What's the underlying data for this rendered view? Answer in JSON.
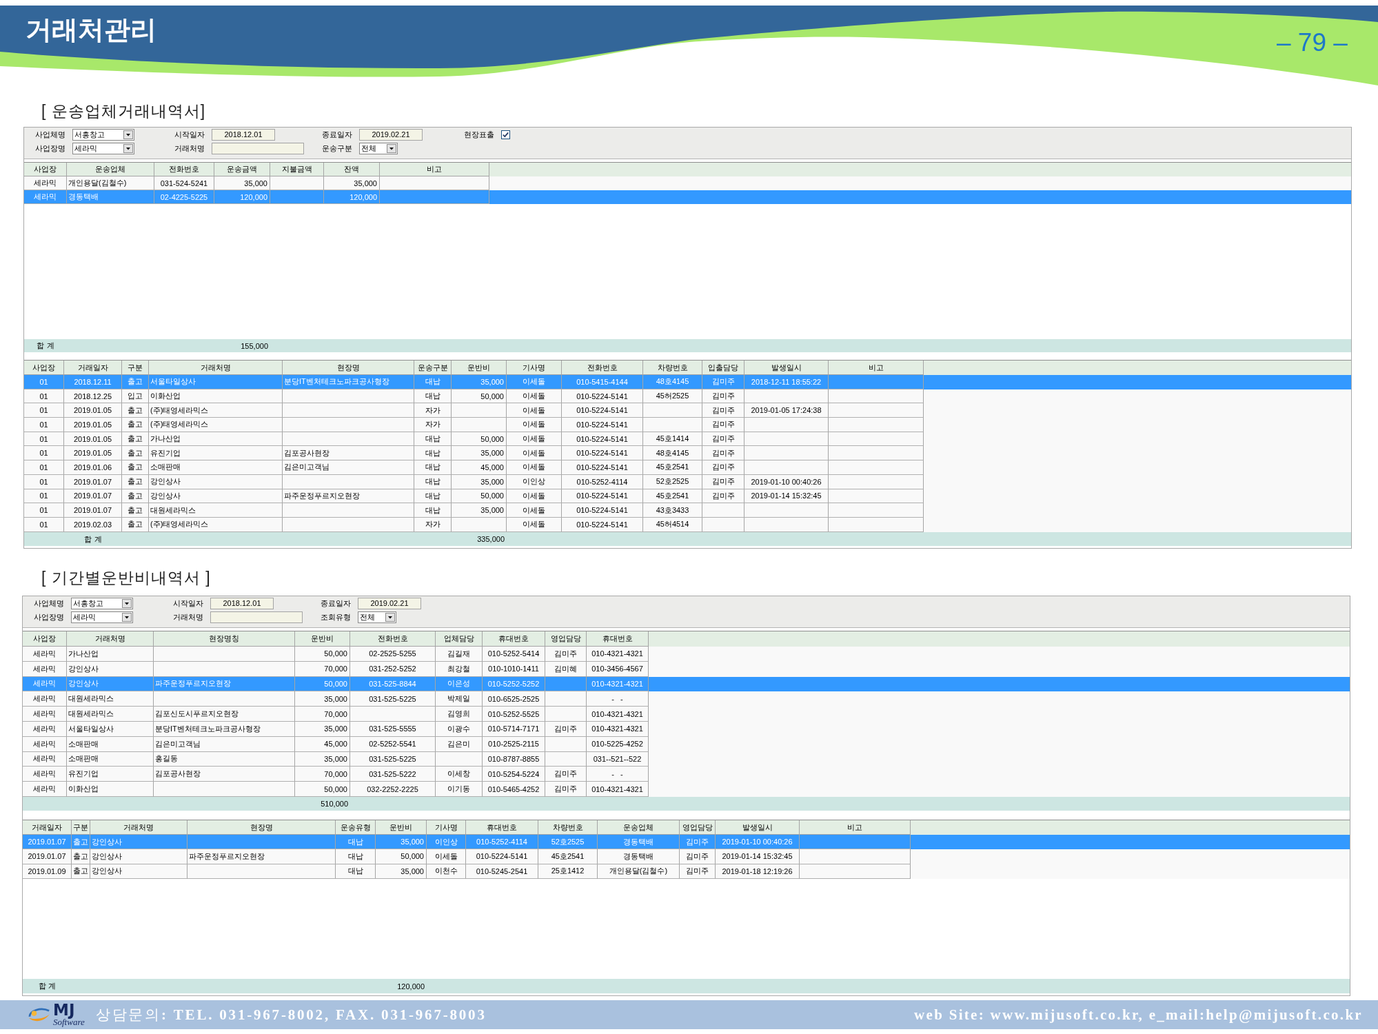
{
  "header": {
    "title": "거래처관리",
    "page_number": "– 79 –"
  },
  "sections": [
    {
      "title": "[ 운송업체거래내역서]",
      "filters": [
        [
          {
            "label": "사업체명",
            "kind": "dropdown",
            "value": "서흥창고"
          },
          {
            "label": "시작일자",
            "kind": "date",
            "value": "2018.12.01"
          },
          {
            "label": "종료일자",
            "kind": "date",
            "value": "2019.02.21"
          },
          {
            "label": "현장표출",
            "kind": "checkbox",
            "checked": true
          }
        ],
        [
          {
            "label": "사업장명",
            "kind": "dropdown",
            "value": "세라믹"
          },
          {
            "label": "거래처명",
            "kind": "text"
          },
          {
            "label": "운송구분",
            "kind": "dropdown",
            "value": "전체"
          }
        ]
      ],
      "tables": [
        {
          "columns": [
            {
              "label": "사업장",
              "total": "합 계"
            },
            {
              "label": "운송업체"
            },
            {
              "label": "전화번호"
            },
            {
              "label": "운송금액",
              "total": "155,000"
            },
            {
              "label": "지불금액"
            },
            {
              "label": "잔액"
            },
            {
              "label": "비고"
            }
          ],
          "rows": [
            {
              "selected": false,
              "cells": [
                "세라믹",
                "개인용달(김철수)",
                "031-524-5241",
                "35,000",
                null,
                "35,000",
                null
              ]
            },
            {
              "selected": true,
              "cells": [
                "세라믹",
                "경동택배",
                "02-4225-5225",
                "120,000",
                null,
                "120,000",
                null
              ]
            }
          ]
        },
        {
          "columns": [
            {
              "label": "사업장"
            },
            {
              "label": "거래일자",
              "total": "합 계"
            },
            {
              "label": "구분"
            },
            {
              "label": "거래처명"
            },
            {
              "label": "현장명"
            },
            {
              "label": "운송구분"
            },
            {
              "label": "운반비",
              "total": "335,000"
            },
            {
              "label": "기사명"
            },
            {
              "label": "전화번호"
            },
            {
              "label": "차량번호"
            },
            {
              "label": "입출담당"
            },
            {
              "label": "발생일시"
            },
            {
              "label": "비고"
            }
          ],
          "rows": [
            {
              "selected": true,
              "cells": [
                "01",
                "2018.12.11",
                "출고",
                "서울타일상사",
                "분당IT벤처테크노파크공사형장",
                "대납",
                "35,000",
                "이세돌",
                "010-5415-4144",
                "48호4145",
                "김미주",
                "2018-12-11 18:55:22",
                null
              ]
            },
            {
              "selected": false,
              "cells": [
                "01",
                "2018.12.25",
                "입고",
                "이화산업",
                null,
                "대납",
                "50,000",
                "이세돌",
                "010-5224-5141",
                "45허2525",
                "김미주",
                null,
                null
              ]
            },
            {
              "selected": false,
              "cells": [
                "01",
                "2019.01.05",
                "출고",
                "(주)태영세라믹스",
                null,
                "자가",
                null,
                "이세돌",
                "010-5224-5141",
                null,
                "김미주",
                "2019-01-05 17:24:38",
                null
              ]
            },
            {
              "selected": false,
              "cells": [
                "01",
                "2019.01.05",
                "출고",
                "(주)태영세라믹스",
                null,
                "자가",
                null,
                "이세돌",
                "010-5224-5141",
                null,
                "김미주",
                null,
                null
              ]
            },
            {
              "selected": false,
              "cells": [
                "01",
                "2019.01.05",
                "출고",
                "가나산업",
                null,
                "대납",
                "50,000",
                "이세돌",
                "010-5224-5141",
                "45호1414",
                "김미주",
                null,
                null
              ]
            },
            {
              "selected": false,
              "cells": [
                "01",
                "2019.01.05",
                "출고",
                "유진기업",
                "김포공사현장",
                "대납",
                "35,000",
                "이세돌",
                "010-5224-5141",
                "48호4145",
                "김미주",
                null,
                null
              ]
            },
            {
              "selected": false,
              "cells": [
                "01",
                "2019.01.06",
                "출고",
                "소매판매",
                "김은미고객님",
                "대납",
                "45,000",
                "이세돌",
                "010-5224-5141",
                "45호2541",
                "김미주",
                null,
                null
              ]
            },
            {
              "selected": false,
              "cells": [
                "01",
                "2019.01.07",
                "출고",
                "강인상사",
                null,
                "대납",
                "35,000",
                "이인상",
                "010-5252-4114",
                "52호2525",
                "김미주",
                "2019-01-10 00:40:26",
                null
              ]
            },
            {
              "selected": false,
              "cells": [
                "01",
                "2019.01.07",
                "출고",
                "강인상사",
                "파주운정푸르지오현장",
                "대납",
                "50,000",
                "이세돌",
                "010-5224-5141",
                "45호2541",
                "김미주",
                "2019-01-14 15:32:45",
                null
              ]
            },
            {
              "selected": false,
              "cells": [
                "01",
                "2019.01.07",
                "출고",
                "대원세라믹스",
                null,
                "대납",
                "35,000",
                "이세돌",
                "010-5224-5141",
                "43호3433",
                null,
                null,
                null
              ]
            },
            {
              "selected": false,
              "cells": [
                "01",
                "2019.02.03",
                "출고",
                "(주)태영세라믹스",
                null,
                "자가",
                null,
                "이세돌",
                "010-5224-5141",
                "45허4514",
                null,
                null,
                null
              ]
            }
          ]
        }
      ]
    },
    {
      "title": "[ 기간별운반비내역서 ]",
      "filters": [
        [
          {
            "label": "사업체명",
            "kind": "dropdown",
            "value": "서흥창고"
          },
          {
            "label": "시작일자",
            "kind": "date",
            "value": "2018.12.01"
          },
          {
            "label": "종료일자",
            "kind": "date",
            "value": "2019.02.21"
          }
        ],
        [
          {
            "label": "사업장명",
            "kind": "dropdown",
            "value": "세라믹"
          },
          {
            "label": "거래처명",
            "kind": "text"
          },
          {
            "label": "조회유형",
            "kind": "dropdown",
            "value": "전체"
          }
        ]
      ],
      "tables": [
        {
          "columns": [
            {
              "label": "사업장"
            },
            {
              "label": "거래처명"
            },
            {
              "label": "현장명칭"
            },
            {
              "label": "운반비",
              "total": "510,000"
            },
            {
              "label": "전화번호"
            },
            {
              "label": "업체담당"
            },
            {
              "label": "휴대번호"
            },
            {
              "label": "영업담당"
            },
            {
              "label": "휴대번호"
            }
          ],
          "rows": [
            {
              "selected": false,
              "cells": [
                "세라믹",
                "가나산업",
                null,
                "50,000",
                "02-2525-5255",
                "김길재",
                "010-5252-5414",
                "김미주",
                "010-4321-4321"
              ]
            },
            {
              "selected": false,
              "cells": [
                "세라믹",
                "강인상사",
                null,
                "70,000",
                "031-252-5252",
                "최강철",
                "010-1010-1411",
                "김미혜",
                "010-3456-4567"
              ]
            },
            {
              "selected": true,
              "cells": [
                "세라믹",
                "강인상사",
                "파주운정푸르지오현장",
                "50,000",
                "031-525-8844",
                "이은성",
                "010-5252-5252",
                null,
                "010-4321-4321"
              ]
            },
            {
              "selected": false,
              "cells": [
                "세라믹",
                "대원세라믹스",
                null,
                "35,000",
                "031-525-5225",
                "박제일",
                "010-6525-2525",
                null,
                "-   -"
              ]
            },
            {
              "selected": false,
              "cells": [
                "세라믹",
                "대원세라믹스",
                "김포신도시푸르지오현장",
                "70,000",
                null,
                "김영희",
                "010-5252-5525",
                null,
                "010-4321-4321"
              ]
            },
            {
              "selected": false,
              "cells": [
                "세라믹",
                "서울타일상사",
                "분당IT벤처테크노파크공사형장",
                "35,000",
                "031-525-5555",
                "이광수",
                "010-5714-7171",
                "김미주",
                "010-4321-4321"
              ]
            },
            {
              "selected": false,
              "cells": [
                "세라믹",
                "소매판매",
                "김은미고객님",
                "45,000",
                "02-5252-5541",
                "김은미",
                "010-2525-2115",
                null,
                "010-5225-4252"
              ]
            },
            {
              "selected": false,
              "cells": [
                "세라믹",
                "소매판매",
                "홍길동",
                "35,000",
                "031-525-5225",
                null,
                "010-8787-8855",
                null,
                "031--521--522"
              ]
            },
            {
              "selected": false,
              "cells": [
                "세라믹",
                "유진기업",
                "김포공사현장",
                "70,000",
                "031-525-5222",
                "이세창",
                "010-5254-5224",
                "김미주",
                "-   -"
              ]
            },
            {
              "selected": false,
              "cells": [
                "세라믹",
                "이화산업",
                null,
                "50,000",
                "032-2252-2225",
                "이기동",
                "010-5465-4252",
                "김미주",
                "010-4321-4321"
              ]
            }
          ]
        },
        {
          "columns": [
            {
              "label": "거래일자",
              "total": "합 계"
            },
            {
              "label": "구분"
            },
            {
              "label": "거래처명"
            },
            {
              "label": "현장명"
            },
            {
              "label": "운송유형"
            },
            {
              "label": "운반비",
              "total": "120,000"
            },
            {
              "label": "기사명"
            },
            {
              "label": "휴대번호"
            },
            {
              "label": "차량번호"
            },
            {
              "label": "운송업체"
            },
            {
              "label": "영업담당"
            },
            {
              "label": "발생일시"
            },
            {
              "label": "비고"
            }
          ],
          "rows": [
            {
              "selected": true,
              "cells": [
                "2019.01.07",
                "출고",
                "강인상사",
                null,
                "대납",
                "35,000",
                "이인상",
                "010-5252-4114",
                "52호2525",
                "경동택배",
                "김미주",
                "2019-01-10 00:40:26",
                null
              ]
            },
            {
              "selected": false,
              "cells": [
                "2019.01.07",
                "출고",
                "강인상사",
                "파주운정푸르지오현장",
                "대납",
                "50,000",
                "이세돌",
                "010-5224-5141",
                "45호2541",
                "경동택배",
                "김미주",
                "2019-01-14 15:32:45",
                null
              ]
            },
            {
              "selected": false,
              "cells": [
                "2019.01.09",
                "출고",
                "강인상사",
                null,
                "대납",
                "35,000",
                "이천수",
                "010-5245-2541",
                "25호1412",
                "개인용달(김철수)",
                "김미주",
                "2019-01-18 12:19:26",
                null
              ]
            }
          ]
        }
      ]
    }
  ],
  "footer": {
    "logo": {
      "text": "MJ",
      "subtext": "Software"
    },
    "contact": "상담문의**: TEL. 031-967-8002, FAX. 031-967-8003**",
    "website": "web Site: www.mijusoft.co.kr, e_mail:help@mijusoft.co.kr"
  }
}
